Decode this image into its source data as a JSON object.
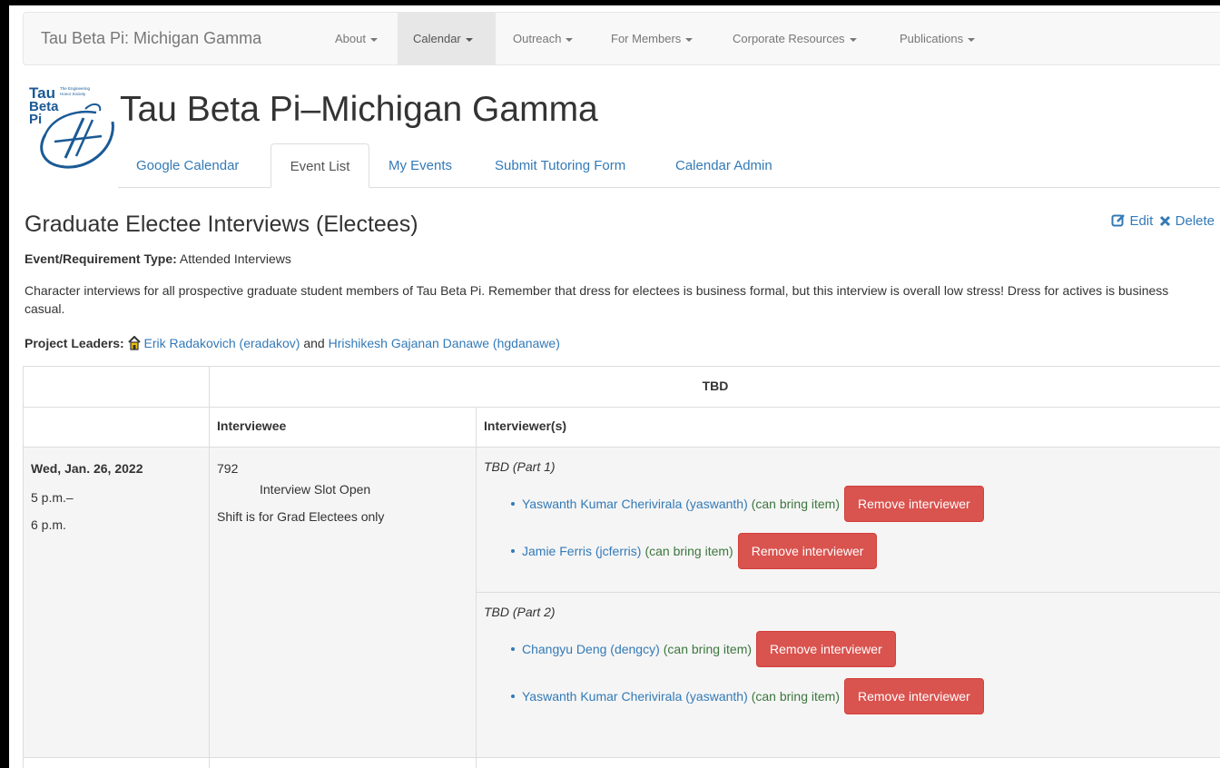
{
  "navbar": {
    "brand": "Tau Beta Pi: Michigan Gamma",
    "items": [
      {
        "label": "About"
      },
      {
        "label": "Calendar"
      },
      {
        "label": "Outreach"
      },
      {
        "label": "For Members"
      },
      {
        "label": "Corporate Resources"
      },
      {
        "label": "Publications"
      }
    ],
    "active_item": "Calendar"
  },
  "logo": {
    "line1": "Tau",
    "line2": "Beta",
    "line3": "Pi",
    "tagline1": "The Engineering",
    "tagline2": "Honor Society"
  },
  "site_title": "Tau Beta Pi–Michigan Gamma",
  "tabs": [
    {
      "label": "Google Calendar"
    },
    {
      "label": "Event List"
    },
    {
      "label": "My Events"
    },
    {
      "label": "Submit Tutoring Form"
    },
    {
      "label": "Calendar Admin"
    }
  ],
  "active_tab": "Event List",
  "event": {
    "title": "Graduate Electee Interviews (Electees)",
    "edit_label": "Edit",
    "delete_label": "Delete",
    "type_label": "Event/Requirement Type:",
    "type_value": "Attended Interviews",
    "description": "Character interviews for all prospective graduate student members of Tau Beta Pi. Remember that dress for electees is business formal, but this interview is overall low stress! Dress for actives is business casual.",
    "leaders_label": "Project Leaders:",
    "leader1": "Erik Radakovich (eradakov)",
    "leaders_and": "and",
    "leader2": "Hrishikesh Gajanan Danawe (hgdanawe)"
  },
  "table": {
    "location_header": "TBD",
    "col_interviewee": "Interviewee",
    "col_interviewers": "Interviewer(s)",
    "row": {
      "date": "Wed, Jan. 26, 2022",
      "start": "5 p.m.–",
      "end": "6 p.m.",
      "slot_number": "792",
      "slot_status": "Interview Slot Open",
      "slot_note": "Shift is for Grad Electees only",
      "parts": [
        {
          "label": "TBD (Part 1)",
          "interviewers": [
            {
              "name": "Yaswanth Kumar Cherivirala (yaswanth)",
              "note": "(can bring item)",
              "button": "Remove interviewer"
            },
            {
              "name": "Jamie Ferris (jcferris)",
              "note": "(can bring item)",
              "button": "Remove interviewer"
            }
          ]
        },
        {
          "label": "TBD (Part 2)",
          "interviewers": [
            {
              "name": "Changyu Deng (dengcy)",
              "note": "(can bring item)",
              "button": "Remove interviewer"
            },
            {
              "name": "Yaswanth Kumar Cherivirala (yaswanth)",
              "note": "(can bring item)",
              "button": "Remove interviewer"
            }
          ]
        }
      ]
    }
  },
  "colors": {
    "link": "#337ab7",
    "danger": "#d9534f",
    "success_text": "#3c763d",
    "navbar_bg": "#f8f8f8"
  }
}
